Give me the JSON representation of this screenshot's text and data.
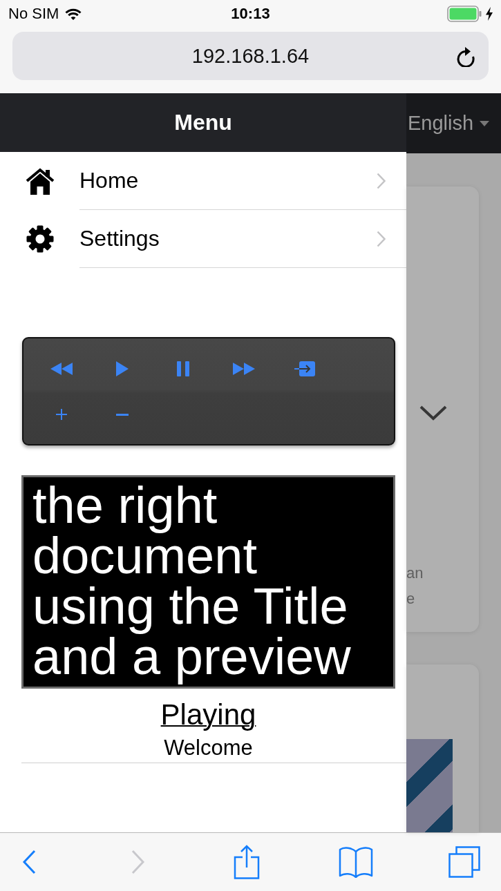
{
  "status_bar": {
    "carrier": "No SIM",
    "time": "10:13",
    "charging": true
  },
  "address_bar": {
    "url": "192.168.1.64"
  },
  "menu_drawer": {
    "open": true,
    "title": "Menu",
    "items": [
      {
        "kind": "home",
        "label": "Home"
      },
      {
        "kind": "settings",
        "label": "Settings"
      }
    ],
    "remote": {
      "rows": [
        {
          "buttons": [
            {
              "kind": "rewind"
            },
            {
              "kind": "play"
            },
            {
              "kind": "pause"
            },
            {
              "kind": "forward"
            },
            {
              "kind": "enter"
            }
          ]
        },
        {
          "buttons": [
            {
              "kind": "plus"
            },
            {
              "kind": "minus"
            }
          ]
        }
      ]
    },
    "preview": {
      "text": "the right document using the Title and a preview"
    },
    "now_playing": {
      "link": "Playing",
      "title": "Welcome"
    }
  },
  "background_page": {
    "language": "English",
    "card_text": [
      "an",
      "e"
    ]
  },
  "toolbar": {
    "buttons": [
      {
        "kind": "back",
        "disabled": false
      },
      {
        "kind": "forward",
        "disabled": true
      },
      {
        "kind": "share",
        "disabled": false
      },
      {
        "kind": "bookmarks",
        "disabled": false
      },
      {
        "kind": "tabs",
        "disabled": false
      }
    ]
  }
}
